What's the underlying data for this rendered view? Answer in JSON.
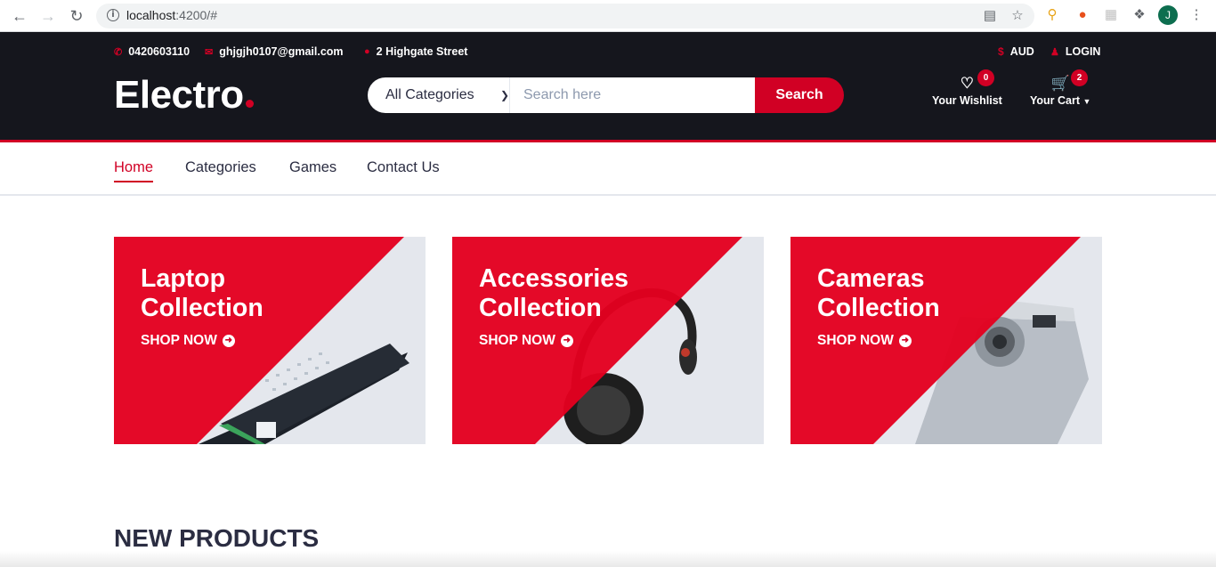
{
  "browser": {
    "url_host": "localhost",
    "url_rest": ":4200/#"
  },
  "topbar": {
    "phone": "0420603110",
    "email": "ghjgjh0107@gmail.com",
    "address": "2 Highgate Street",
    "currency": "AUD",
    "login": "LOGIN"
  },
  "header": {
    "logo": "Electro",
    "category_select": "All Categories",
    "search_placeholder": "Search here",
    "search_button": "Search",
    "wishlist_label": "Your Wishlist",
    "wishlist_count": "0",
    "cart_label": "Your Cart",
    "cart_count": "2"
  },
  "nav": {
    "items": [
      "Home",
      "Categories",
      "Games",
      "Contact Us"
    ],
    "active": "Home"
  },
  "collections": [
    {
      "line1": "Laptop",
      "line2": "Collection",
      "cta": "SHOP NOW"
    },
    {
      "line1": "Accessories",
      "line2": "Collection",
      "cta": "SHOP NOW"
    },
    {
      "line1": "Cameras",
      "line2": "Collection",
      "cta": "SHOP NOW"
    }
  ],
  "sections": {
    "new_products": "NEW PRODUCTS"
  },
  "colors": {
    "brand_red": "#d10024",
    "header_dark": "#15161d",
    "card_bg": "#e4e7ed",
    "text_dark": "#2b2d42"
  },
  "icons": {
    "phone": "phone-icon",
    "email": "envelope-icon",
    "address": "map-marker-icon",
    "currency": "dollar-icon",
    "login": "user-icon",
    "wishlist": "heart-icon",
    "cart": "shopping-cart-icon",
    "cta": "arrow-circle-right-icon"
  }
}
